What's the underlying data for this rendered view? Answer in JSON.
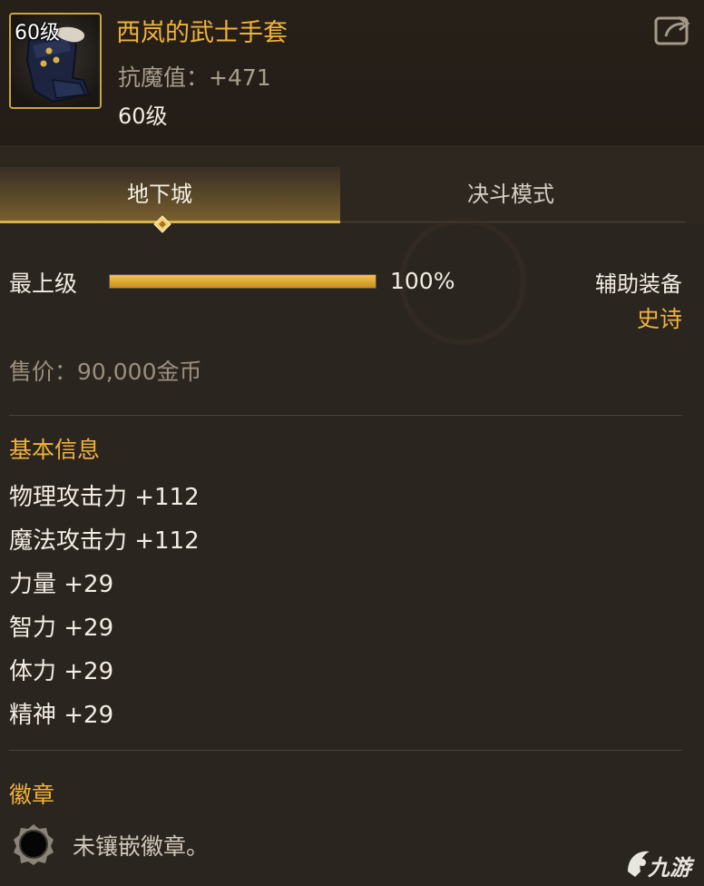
{
  "item": {
    "level_badge": "60级",
    "name": "西岚的武士手套",
    "stat": "抗魔值：+471",
    "level": "60级"
  },
  "tabs": [
    {
      "label": "地下城",
      "active": true
    },
    {
      "label": "决斗模式",
      "active": false
    }
  ],
  "upgrade": {
    "label": "最上级",
    "progress_text": "100%",
    "progress_fraction": 1.0
  },
  "equip": {
    "type": "辅助装备",
    "rarity": "史诗"
  },
  "price": "售价：90,000金币",
  "basic_info": {
    "title": "基本信息",
    "stats": [
      "物理攻击力 +112",
      "魔法攻击力 +112",
      "力量 +29",
      "智力 +29",
      "体力 +29",
      "精神 +29"
    ]
  },
  "emblem": {
    "title": "徽章",
    "empty_text": "未镶嵌徽章。"
  },
  "watermark": {
    "text": "九游"
  },
  "colors": {
    "gold": "#f0b33b",
    "background": "#2b2520",
    "frame_gold": "#c9a445"
  }
}
